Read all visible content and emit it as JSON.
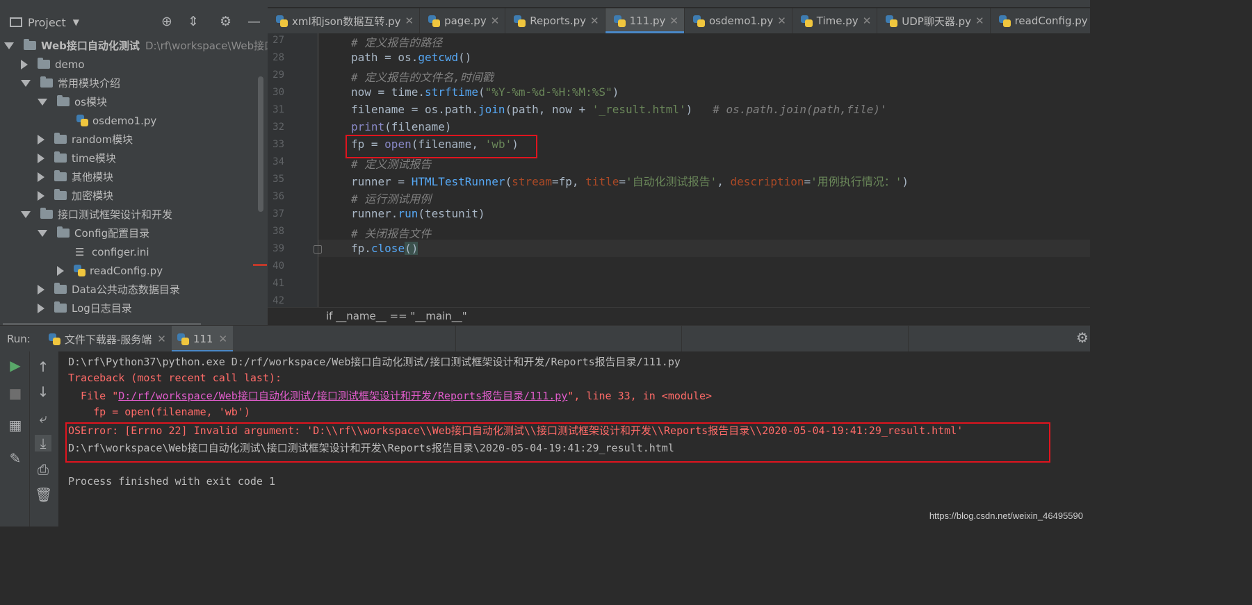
{
  "project_panel": {
    "title": "Project",
    "tree": [
      {
        "label": "Web接口自动化测试",
        "path": "D:\\rf\\workspace\\Web接口"
      },
      {
        "label": "demo"
      },
      {
        "label": "常用模块介绍"
      },
      {
        "label": "os模块"
      },
      {
        "label": "osdemo1.py"
      },
      {
        "label": "random模块"
      },
      {
        "label": "time模块"
      },
      {
        "label": "其他模块"
      },
      {
        "label": "加密模块"
      },
      {
        "label": "接口测试框架设计和开发"
      },
      {
        "label": "Config配置目录"
      },
      {
        "label": "configer.ini"
      },
      {
        "label": "readConfig.py"
      },
      {
        "label": "Data公共动态数据目录"
      },
      {
        "label": "Log日志目录"
      }
    ]
  },
  "editor_tabs": [
    {
      "label": "xml和json数据互转.py"
    },
    {
      "label": "page.py"
    },
    {
      "label": "Reports.py"
    },
    {
      "label": "111.py",
      "active": true
    },
    {
      "label": "osdemo1.py"
    },
    {
      "label": "Time.py"
    },
    {
      "label": "UDP聊天器.py"
    },
    {
      "label": "readConfig.py"
    }
  ],
  "editor": {
    "line_numbers": [
      "27",
      "28",
      "29",
      "30",
      "31",
      "32",
      "33",
      "34",
      "35",
      "36",
      "37",
      "38",
      "39",
      "40",
      "41",
      "42"
    ],
    "code": {
      "l27": "# 定义报告的路径",
      "l28_a": "path = os.",
      "l28_b": "getcwd",
      "l28_c": "()",
      "l29": "# 定义报告的文件名,时间戳",
      "l30_a": "now = time.",
      "l30_b": "strftime",
      "l30_c": "(",
      "l30_d": "\"%Y-%m-%d-%H:%M:%S\"",
      "l30_e": ")",
      "l31_a": "filename = os.path.",
      "l31_b": "join",
      "l31_c": "(path, now + ",
      "l31_d": "'_result.html'",
      "l31_e": ")   ",
      "l31_f": "# os.path.join(path,file)'",
      "l32_a": "print",
      "l32_b": "(filename)",
      "l33_a": "fp = ",
      "l33_b": "open",
      "l33_c": "(filename, ",
      "l33_d": "'wb'",
      "l33_e": ")",
      "l34": "# 定义测试报告",
      "l35_a": "runner = ",
      "l35_b": "HTMLTestRunner",
      "l35_c": "(",
      "l35_d": "stream",
      "l35_e": "=fp, ",
      "l35_f": "title",
      "l35_g": "=",
      "l35_h": "'自动化测试报告'",
      "l35_i": ", ",
      "l35_j": "description",
      "l35_k": "=",
      "l35_l": "'用例执行情况：'",
      "l35_m": ")",
      "l36": "# 运行测试用例",
      "l37_a": "runner.",
      "l37_b": "run",
      "l37_c": "(testunit)",
      "l38": "# 关闭报告文件",
      "l39_a": "fp.",
      "l39_b": "close",
      "l39_c": "()"
    },
    "breadcrumb": "if __name__ == \"__main__\""
  },
  "run_panel": {
    "label": "Run:",
    "tabs": [
      {
        "label": "文件下载器-服务端"
      },
      {
        "label": "111",
        "active": true
      }
    ],
    "console": {
      "cmd": "D:\\rf\\Python37\\python.exe D:/rf/workspace/Web接口自动化测试/接口测试框架设计和开发/Reports报告目录/111.py",
      "traceback": "Traceback (most recent call last):",
      "file_prefix": "  File \"",
      "file_link": "D:/rf/workspace/Web接口自动化测试/接口测试框架设计和开发/Reports报告目录/111.py",
      "file_suffix": "\", line 33, in <module>",
      "code_line": "    fp = open(filename, 'wb')",
      "error": "OSError: [Errno 22] Invalid argument: 'D:\\\\rf\\\\workspace\\\\Web接口自动化测试\\\\接口测试框架设计和开发\\\\Reports报告目录\\\\2020-05-04-19:41:29_result.html'",
      "printed_path": "D:\\rf\\workspace\\Web接口自动化测试\\接口测试框架设计和开发\\Reports报告目录\\2020-05-04-19:41:29_result.html",
      "finish": "Process finished with exit code 1"
    }
  },
  "watermark": "https://blog.csdn.net/weixin_46495590",
  "colors": {
    "highlight_box": "#e0141e",
    "active_tab_accent": "#4a88c7",
    "error_text": "#ff6b68"
  }
}
